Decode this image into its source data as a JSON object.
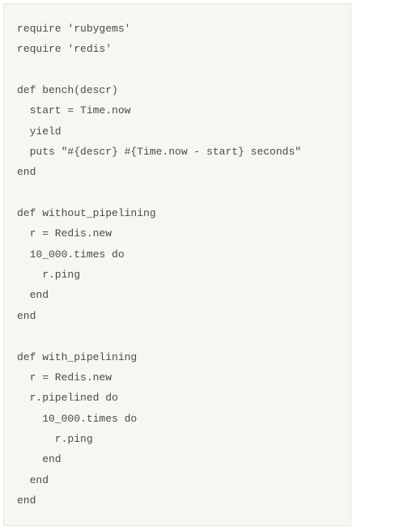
{
  "code": {
    "lines": [
      "require 'rubygems'",
      "require 'redis'",
      "",
      "def bench(descr)",
      "  start = Time.now",
      "  yield",
      "  puts \"#{descr} #{Time.now - start} seconds\"",
      "end",
      "",
      "def without_pipelining",
      "  r = Redis.new",
      "  10_000.times do",
      "    r.ping",
      "  end",
      "end",
      "",
      "def with_pipelining",
      "  r = Redis.new",
      "  r.pipelined do",
      "    10_000.times do",
      "      r.ping",
      "    end",
      "  end",
      "end"
    ]
  }
}
